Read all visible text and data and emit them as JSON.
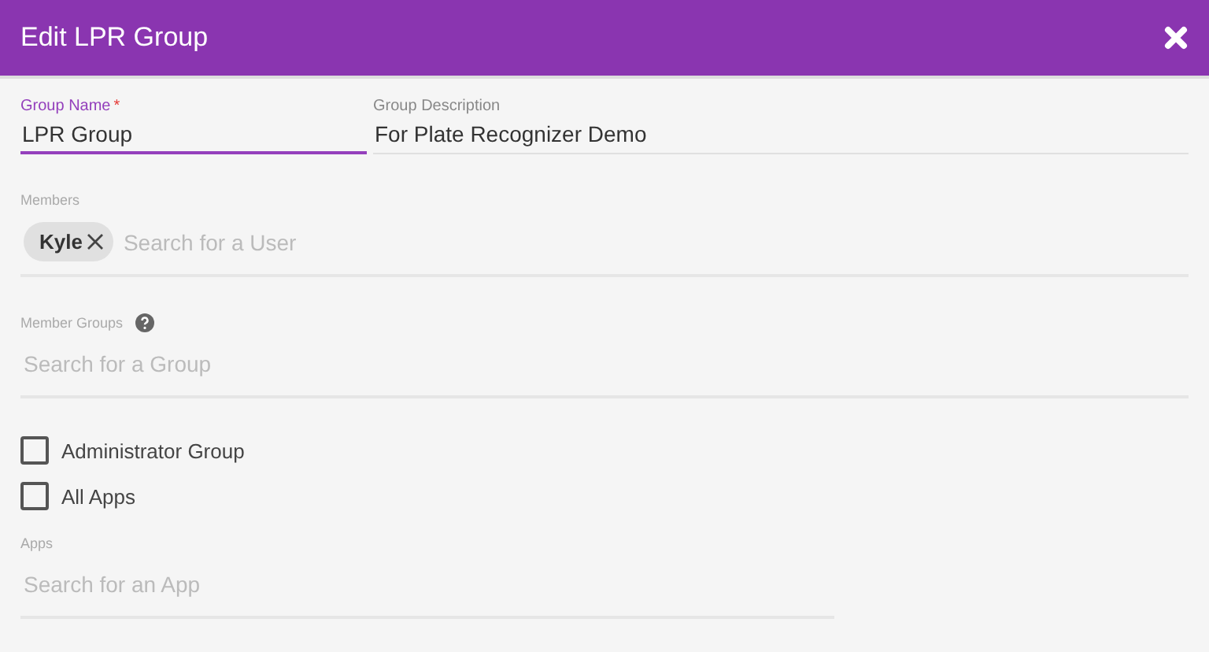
{
  "window": {
    "title": "Edit LPR Group"
  },
  "fields": [
    {
      "label": "Group Name",
      "required_mark": "*",
      "focused": true,
      "value": "LPR Group"
    },
    {
      "label": "Group Description",
      "focused": false,
      "value": "For Plate Recognizer Demo"
    }
  ],
  "members": {
    "label": "Members",
    "chips": [
      "Kyle"
    ],
    "placeholder": "Search for a User"
  },
  "member_groups": {
    "label": "Member Groups",
    "help": true,
    "placeholder": "Search for a Group"
  },
  "checkboxes": [
    {
      "label": "Administrator Group",
      "checked": false
    },
    {
      "label": "All Apps",
      "checked": false
    }
  ],
  "apps": {
    "label": "Apps",
    "placeholder": "Search for an App"
  }
}
